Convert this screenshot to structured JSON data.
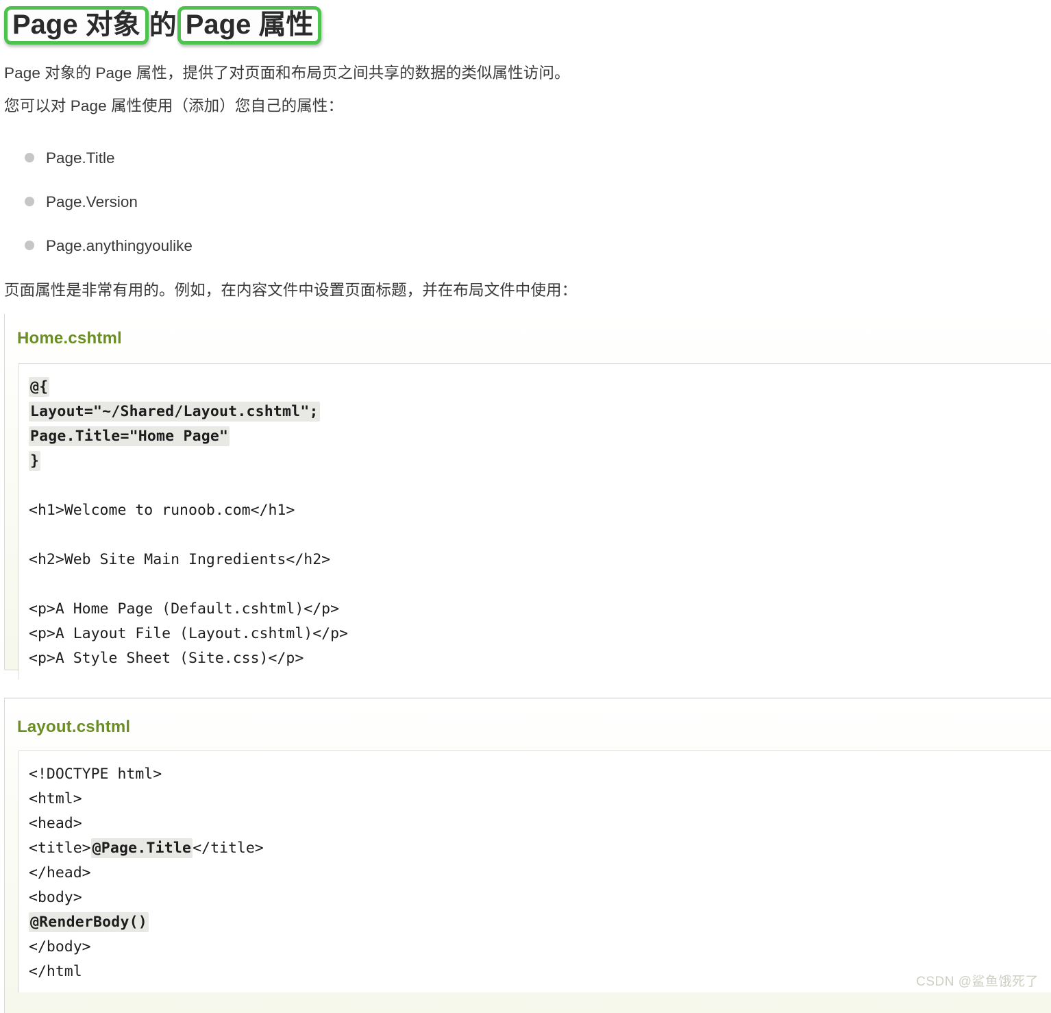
{
  "title": {
    "highlight_1": "Page 对象",
    "plain_1": "的",
    "highlight_2": "Page 属性",
    "highlight_color": "#4cc34c"
  },
  "paragraphs": {
    "intro_1": "Page 对象的 Page 属性，提供了对页面和布局页之间共享的数据的类似属性访问。",
    "intro_2": "您可以对 Page 属性使用（添加）您自己的属性：",
    "usecase": "页面属性是非常有用的。例如，在内容文件中设置页面标题，并在布局文件中使用："
  },
  "bullet_list": [
    {
      "label": "Page.Title"
    },
    {
      "label": "Page.Version"
    },
    {
      "label": "Page.anythingyoulike"
    }
  ],
  "examples": [
    {
      "title": "Home.cshtml",
      "title_color": "#6b8e23",
      "lines": [
        {
          "parts": [
            {
              "text": "@{",
              "highlight": true
            }
          ]
        },
        {
          "parts": [
            {
              "text": "Layout=\"~/Shared/Layout.cshtml\";",
              "highlight": true
            }
          ]
        },
        {
          "parts": [
            {
              "text": "Page.Title=\"Home Page\"",
              "highlight": true
            }
          ]
        },
        {
          "parts": [
            {
              "text": "}",
              "highlight": true
            }
          ]
        },
        {
          "parts": []
        },
        {
          "parts": [
            {
              "text": "<h1>Welcome to runoob.com</h1>",
              "highlight": false
            }
          ]
        },
        {
          "parts": []
        },
        {
          "parts": [
            {
              "text": "<h2>Web Site Main Ingredients</h2>",
              "highlight": false
            }
          ]
        },
        {
          "parts": []
        },
        {
          "parts": [
            {
              "text": "<p>A Home Page (Default.cshtml)</p>",
              "highlight": false
            }
          ]
        },
        {
          "parts": [
            {
              "text": "<p>A Layout File (Layout.cshtml)</p>",
              "highlight": false
            }
          ]
        },
        {
          "parts": [
            {
              "text": "<p>A Style Sheet (Site.css)</p>",
              "highlight": false
            }
          ]
        }
      ]
    },
    {
      "title": "Layout.cshtml",
      "title_color": "#6b8e23",
      "lines": [
        {
          "parts": [
            {
              "text": "<!DOCTYPE html>",
              "highlight": false
            }
          ]
        },
        {
          "parts": [
            {
              "text": "<html>",
              "highlight": false
            }
          ]
        },
        {
          "parts": [
            {
              "text": "<head>",
              "highlight": false
            }
          ]
        },
        {
          "parts": [
            {
              "text": "<title>",
              "highlight": false
            },
            {
              "text": "@Page.Title",
              "highlight": true
            },
            {
              "text": "</title>",
              "highlight": false
            }
          ]
        },
        {
          "parts": [
            {
              "text": "</head>",
              "highlight": false
            }
          ]
        },
        {
          "parts": [
            {
              "text": "<body>",
              "highlight": false
            }
          ]
        },
        {
          "parts": [
            {
              "text": "@RenderBody()",
              "highlight": true
            }
          ]
        },
        {
          "parts": [
            {
              "text": "</body>",
              "highlight": false
            }
          ]
        },
        {
          "parts": [
            {
              "text": "</html",
              "highlight": false
            }
          ]
        }
      ]
    }
  ],
  "watermark": "CSDN @鲨鱼饿死了"
}
